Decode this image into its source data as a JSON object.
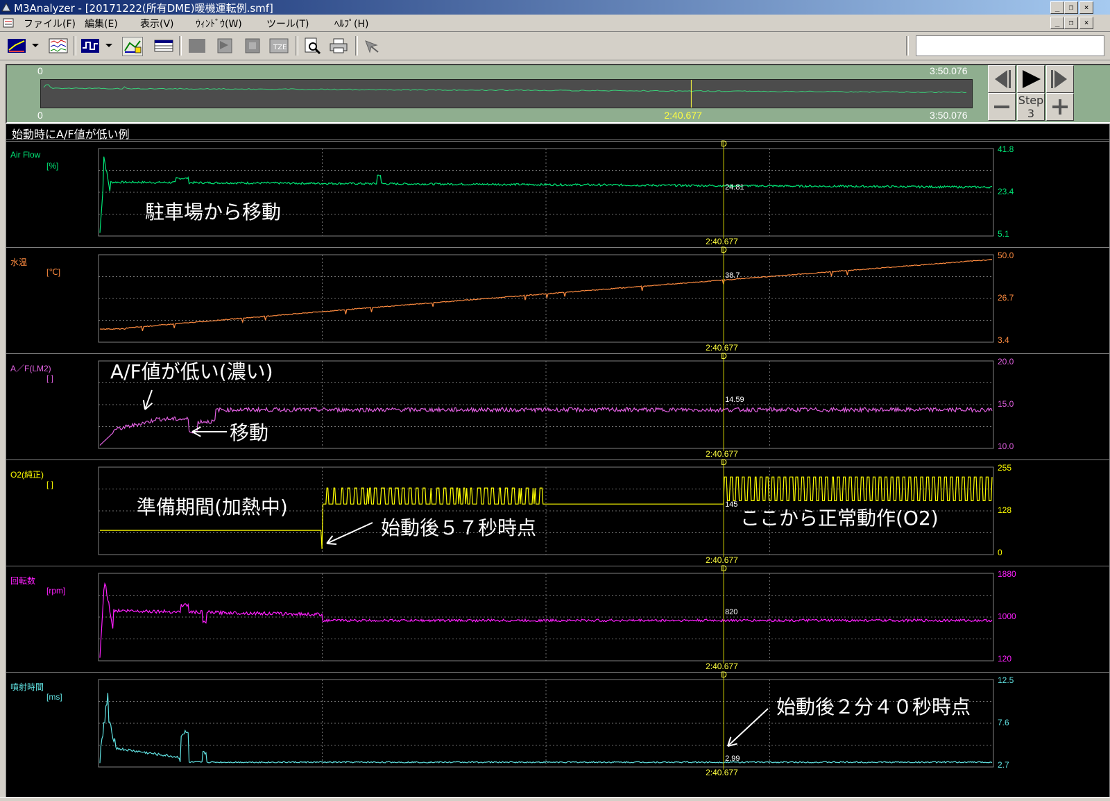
{
  "window": {
    "title": "M3Analyzer - [20171222(所有DME)暖機運転例.smf]"
  },
  "menu": [
    "ファイル(F)",
    "編集(E)",
    "表示(V)",
    "ｳｨﾝﾄﾞｳ(W)",
    "ツール(T)",
    "ﾍﾙﾌﾟ(H)"
  ],
  "toolbar": {
    "buttons": [
      "graph-mode-icon",
      "dropdown-icon",
      "multi-graph-icon",
      "signal-icon",
      "dropdown-icon",
      "chart-edit-icon",
      "data-table-icon",
      "gray-square-icon",
      "gray-flag-icon",
      "gray-frame-icon",
      "tze-icon",
      "print-preview-icon",
      "printer-icon",
      "disabled-tool-icon"
    ]
  },
  "overview": {
    "start_top": "0",
    "end_top": "3:50.076",
    "start_bottom": "0",
    "cursor_time": "2:40.677",
    "end_bottom": "3:50.076",
    "cursor_fraction": 0.6985,
    "step_label": "Step",
    "step_value": "3"
  },
  "chart_title": "始動時にA/F値が低い例",
  "cursor": {
    "marker": "D",
    "time": "2:40.677",
    "fraction": 0.6985
  },
  "panels": [
    {
      "name": "Air Flow",
      "unit": "[%]",
      "color": "#00e676",
      "ymax": "41.8",
      "ymid": "23.4",
      "ymin": "5.1",
      "cursor_value": "24.81"
    },
    {
      "name": "水温",
      "unit": "[℃]",
      "color": "#ff8c40",
      "ymax": "50.0",
      "ymid": "26.7",
      "ymin": "3.4",
      "cursor_value": "38.7"
    },
    {
      "name": "A／F(LM2)",
      "unit": "[ ]",
      "color": "#e060e0",
      "ymax": "20.0",
      "ymid": "15.0",
      "ymin": "10.0",
      "cursor_value": "14.59"
    },
    {
      "name": "O2(純正)",
      "unit": "[ ]",
      "color": "#ffff00",
      "ymax": "255",
      "ymid": "128",
      "ymin": "0",
      "cursor_value": "145"
    },
    {
      "name": "回転数",
      "unit": "[rpm]",
      "color": "#ff20ff",
      "ymax": "1880",
      "ymid": "1000",
      "ymin": "120",
      "cursor_value": "820"
    },
    {
      "name": "噴射時間",
      "unit": "[ms]",
      "color": "#60e0e0",
      "ymax": "12.5",
      "ymid": "7.6",
      "ymin": "2.7",
      "cursor_value": "2.99"
    }
  ],
  "annotations": {
    "a1": "駐車場から移動",
    "a2": "A/F値が低い(濃い)",
    "a3": "移動",
    "a4": "準備期間(加熱中)",
    "a5": "始動後５７秒時点",
    "a6": "ここから正常動作(O2)",
    "a7": "始動後２分４０秒時点"
  }
}
